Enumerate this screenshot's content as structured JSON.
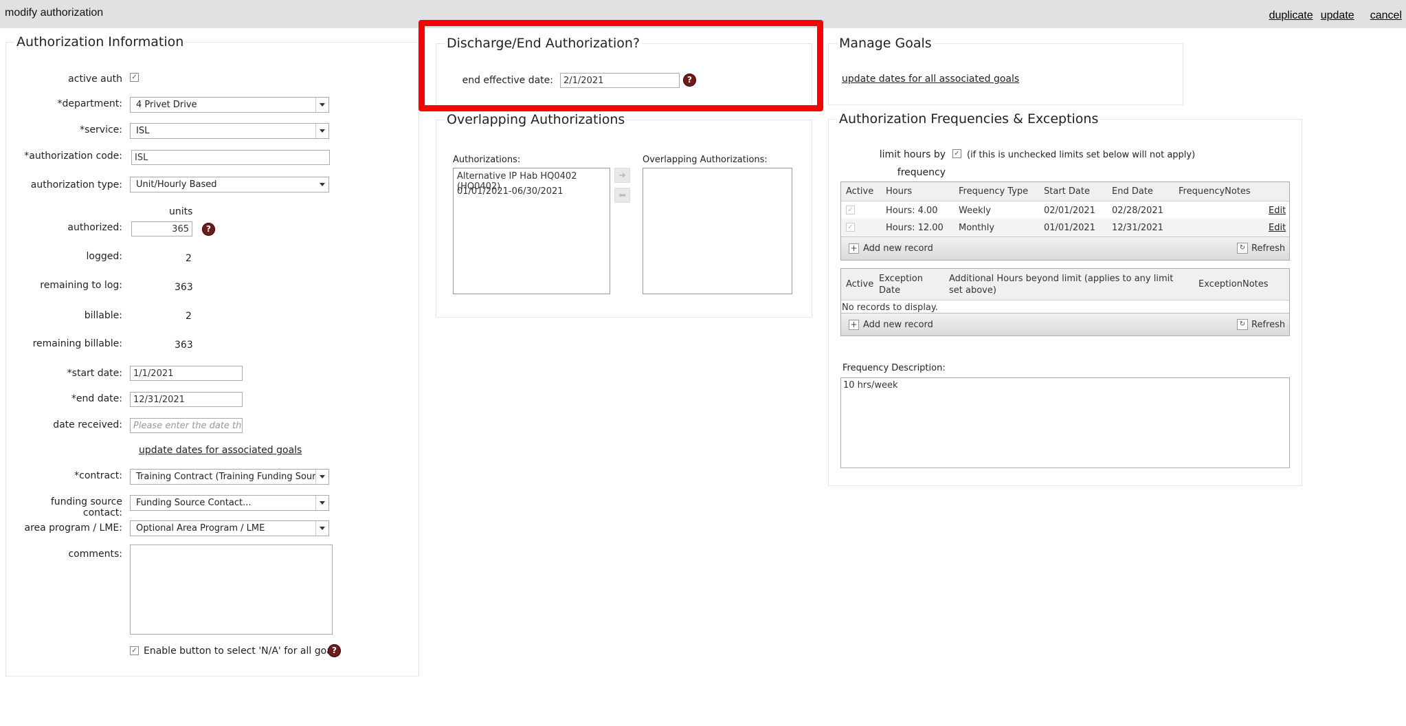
{
  "window": {
    "title": "modify authorization",
    "duplicate": "duplicate",
    "update": "update",
    "cancel": "cancel"
  },
  "auth_info": {
    "legend": "Authorization Information",
    "active_auth_label": "active auth",
    "department_label": "*department:",
    "department_value": "4 Privet Drive",
    "service_label": "*service:",
    "service_value": "ISL",
    "auth_code_label": "*authorization code:",
    "auth_code_value": "ISL",
    "auth_type_label": "authorization type:",
    "auth_type_value": "Unit/Hourly Based",
    "units_label": "units",
    "authorized_label": "authorized:",
    "authorized_value": "365",
    "logged_label": "logged:",
    "logged_value": "2",
    "remaining_log_label": "remaining to log:",
    "remaining_log_value": "363",
    "billable_label": "billable:",
    "billable_value": "2",
    "remaining_billable_label": "remaining billable:",
    "remaining_billable_value": "363",
    "start_date_label": "*start date:",
    "start_date_value": "1/1/2021",
    "end_date_label": "*end date:",
    "end_date_value": "12/31/2021",
    "date_received_label": "date received:",
    "date_received_placeholder": "Please enter the date the au",
    "update_goals_link": "update dates for associated goals",
    "contract_label": "*contract:",
    "contract_value": "Training Contract (Training Funding Source",
    "funding_contact_label": "funding source contact:",
    "funding_contact_value": "Funding Source Contact...",
    "area_program_label": "area program / LME:",
    "area_program_value": "Optional Area Program / LME",
    "comments_label": "comments:",
    "na_goals_label": "Enable button to select 'N/A' for all goals"
  },
  "discharge": {
    "legend": "Discharge/End Authorization?",
    "end_effective_label": "end effective date:",
    "end_effective_value": "2/1/2021"
  },
  "overlapping": {
    "legend": "Overlapping Authorizations",
    "authorizations_label": "Authorizations:",
    "auth_items": [
      "Alternative IP Hab HQ0402 (HQ0402)",
      "01/01/2021-06/30/2021"
    ],
    "overlapping_label": "Overlapping Authorizations:",
    "move_right": "➜",
    "move_left": "⬅"
  },
  "goals": {
    "legend": "Manage Goals",
    "update_all_link": "update dates for all associated goals"
  },
  "frequencies": {
    "legend": "Authorization Frequencies & Exceptions",
    "limit_label_1": "limit hours by",
    "limit_label_2": "frequency",
    "limit_note": "(if this is unchecked limits set below will not apply)",
    "freq_headers": [
      "Active",
      "Hours",
      "Frequency Type",
      "Start Date",
      "End Date",
      "FrequencyNotes"
    ],
    "freq_rows": [
      {
        "hours": "Hours: 4.00",
        "type": "Weekly",
        "start": "02/01/2021",
        "end": "02/28/2021",
        "notes": "",
        "edit": "Edit"
      },
      {
        "hours": "Hours: 12.00",
        "type": "Monthly",
        "start": "01/01/2021",
        "end": "12/31/2021",
        "notes": "",
        "edit": "Edit"
      }
    ],
    "add_new": "Add new record",
    "refresh": "Refresh",
    "exc_headers": [
      "Active",
      "Exception Date",
      "Additional Hours beyond limit (applies to any limit set above)",
      "ExceptionNotes"
    ],
    "no_records": "No records to display.",
    "desc_label": "Frequency Description:",
    "desc_value": "10 hrs/week"
  }
}
